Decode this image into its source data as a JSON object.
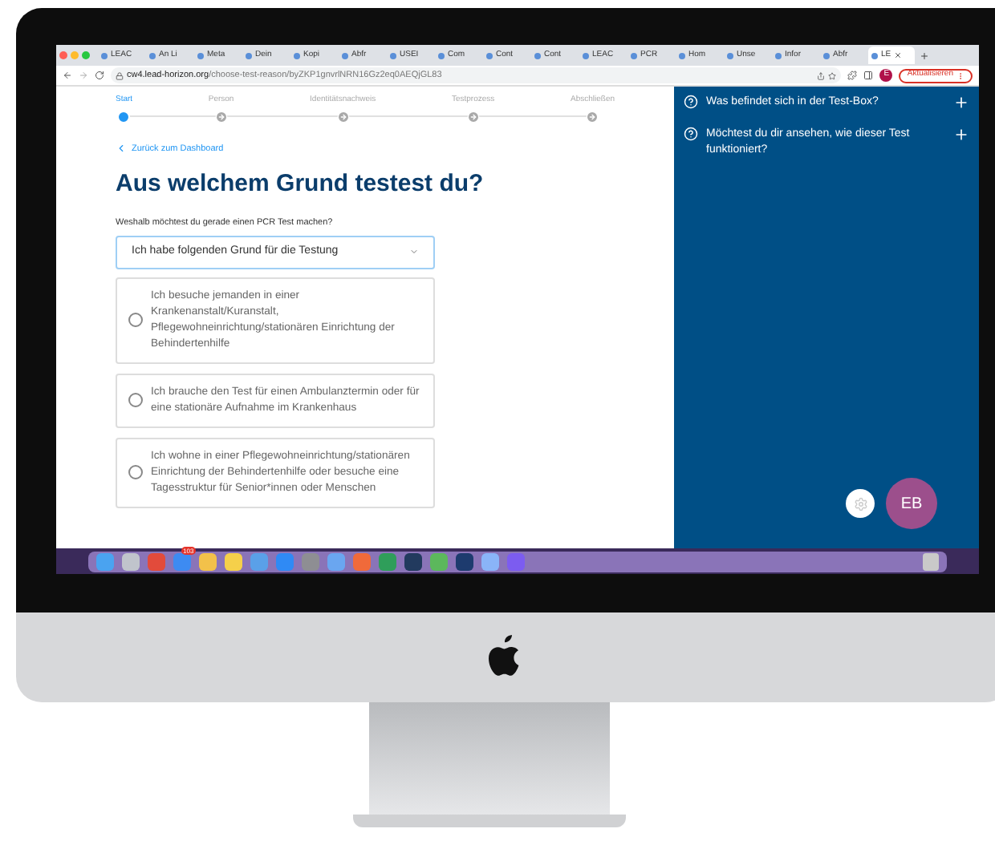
{
  "browser": {
    "tabs": [
      {
        "label": "LEAC",
        "selected": false
      },
      {
        "label": "An Li",
        "selected": false
      },
      {
        "label": "Meta",
        "selected": false
      },
      {
        "label": "Dein",
        "selected": false
      },
      {
        "label": "Kopi",
        "selected": false
      },
      {
        "label": "Abfr",
        "selected": false
      },
      {
        "label": "USEI",
        "selected": false
      },
      {
        "label": "Com",
        "selected": false
      },
      {
        "label": "Cont",
        "selected": false
      },
      {
        "label": "Cont",
        "selected": false
      },
      {
        "label": "LEAC",
        "selected": false
      },
      {
        "label": "PCR",
        "selected": false
      },
      {
        "label": "Hom",
        "selected": false
      },
      {
        "label": "Unse",
        "selected": false
      },
      {
        "label": "Infor",
        "selected": false
      },
      {
        "label": "Abfr",
        "selected": false
      },
      {
        "label": "LE",
        "selected": true
      }
    ],
    "url_host": "cw4.lead-horizon.org",
    "url_path": "/choose-test-reason/byZKP1gnvrlNRN16Gz2eq0AEQjGL83",
    "profile": "E",
    "update_button": "Aktualisieren"
  },
  "stepper": [
    {
      "label": "Start",
      "selected": true
    },
    {
      "label": "Person",
      "selected": false
    },
    {
      "label": "Identitätsnachweis",
      "selected": false
    },
    {
      "label": "Testprozess",
      "selected": false
    },
    {
      "label": "Abschließen",
      "selected": false
    }
  ],
  "back_link": "Zurück zum Dashboard",
  "heading": "Aus welchem Grund testest du?",
  "question": "Weshalb möchtest du gerade einen PCR Test machen?",
  "select": {
    "value": "Ich habe folgenden Grund für die Testung"
  },
  "options": [
    {
      "label": "Ich besuche jemanden in einer Krankenanstalt/Kuranstalt, Pflegewohneinrichtung/stationären Einrichtung der Behindertenhilfe",
      "selected": false
    },
    {
      "label": "Ich brauche den Test für einen Ambulanztermin oder für eine stationäre Aufnahme im Krankenhaus",
      "selected": false
    },
    {
      "label": "Ich wohne in einer Pflegewohneinrichtung/stationären Einrichtung der Behindertenhilfe oder besuche eine Tagesstruktur für Senior*innen oder Menschen",
      "selected": false
    }
  ],
  "faq": [
    {
      "question": "Was befindet sich in der Test-Box?",
      "expanded": false
    },
    {
      "question": "Möchtest du dir ansehen, wie dieser Test funktioniert?",
      "expanded": false
    }
  ],
  "avatar": "EB",
  "dock": {
    "mail_badge": "103"
  }
}
